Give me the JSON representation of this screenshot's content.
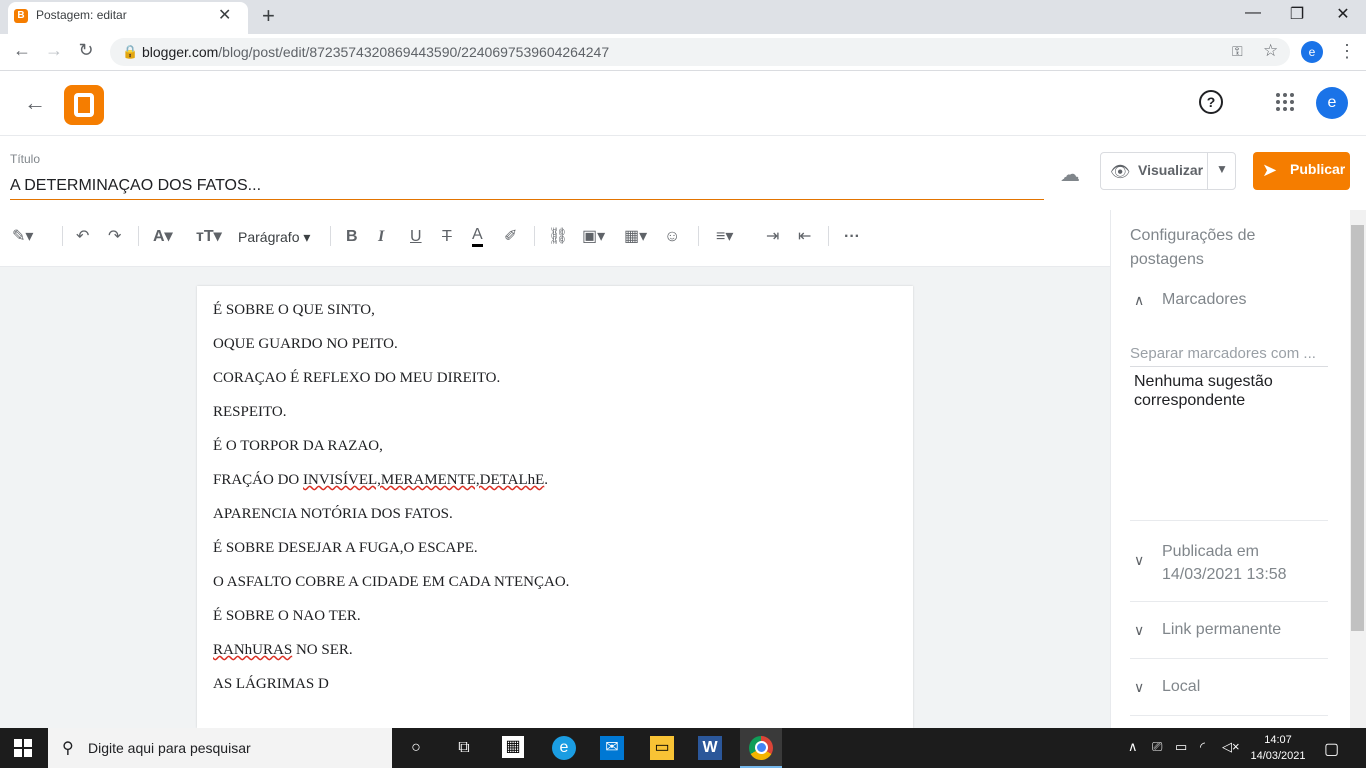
{
  "browser": {
    "tab_title": "Postagem: editar",
    "tab_favicon_letter": "B",
    "url_host": "blogger.com",
    "url_path": "/blog/post/edit/8723574320869443590/2240697539604264247",
    "profile_letter": "e"
  },
  "header": {
    "avatar_letter": "e",
    "help_symbol": "?"
  },
  "post": {
    "title_label": "Título",
    "title": "A DETERMINAÇAO DOS FATOS...",
    "preview_label": "Visualizar",
    "publish_label": "Publicar"
  },
  "toolbar": {
    "paragraph_label": "Parágrafo"
  },
  "body_lines": [
    " É SOBRE O QUE SINTO,",
    "OQUE GUARDO NO PEITO.",
    "CORAÇAO É REFLEXO DO MEU DIREITO.",
    "RESPEITO.",
    "É O TORPOR DA RAZAO,",
    "FRAÇÁO DO ",
    "INVISÍVEL,MERAMENTE,DETALhE",
    ".",
    "APARENCIA NOTÓRIA DOS FATOS.",
    "É SOBRE DESEJAR A FUGA,O ESCAPE.",
    "O ASFALTO COBRE A CIDADE EM CADA NTENÇAO.",
    "É SOBRE O NAO TER.",
    "RANhURAS",
    " NO SER.",
    "AS LÁGRIMAS D"
  ],
  "sidebar": {
    "title": "Configurações de postagens",
    "labels_section": "Marcadores",
    "labels_placeholder": "Separar marcadores com ...",
    "no_suggestion": "Nenhuma sugestão correspondente",
    "published_label": "Publicada em",
    "published_date": "14/03/2021 13:58",
    "permalink": "Link permanente",
    "location": "Local"
  },
  "taskbar": {
    "search_placeholder": "Digite aqui para pesquisar",
    "time": "14:07",
    "date": "14/03/2021"
  },
  "colors": {
    "accent": "#f57d00",
    "blue": "#1a73e8"
  }
}
